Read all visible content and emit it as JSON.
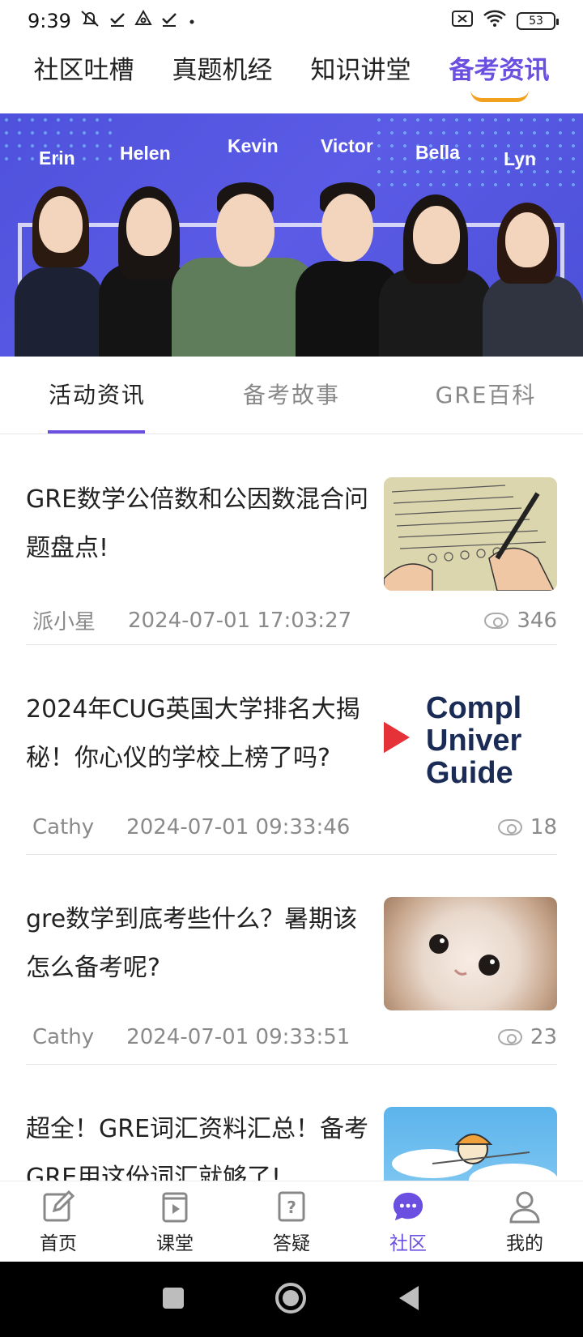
{
  "status": {
    "time": "9:39",
    "battery": "53"
  },
  "top_tabs": [
    {
      "label": "社区吐槽"
    },
    {
      "label": "真题机经"
    },
    {
      "label": "知识讲堂"
    },
    {
      "label": "备考资讯",
      "active": true
    }
  ],
  "banner": {
    "teachers": [
      "Erin",
      "Helen",
      "Kevin",
      "Victor",
      "Bella",
      "Lyn"
    ]
  },
  "sub_tabs": [
    {
      "label": "活动资讯",
      "active": true
    },
    {
      "label": "备考故事"
    },
    {
      "label": "GRE百科"
    }
  ],
  "articles": [
    {
      "title": "GRE数学公倍数和公因数混合问题盘点!",
      "author": "派小星",
      "date": "2024-07-01 17:03:27",
      "views": "346"
    },
    {
      "title": "2024年CUG英国大学排名大揭秘！你心仪的学校上榜了吗?",
      "author": "Cathy",
      "date": "2024-07-01 09:33:46",
      "views": "18",
      "thumb_text": [
        "Compl",
        "Univer",
        "Guide"
      ]
    },
    {
      "title": "gre数学到底考些什么？暑期该怎么备考呢?",
      "author": "Cathy",
      "date": "2024-07-01 09:33:51",
      "views": "23"
    },
    {
      "title": "超全！GRE词汇资料汇总！备考GRE用这份词汇就够了!",
      "author": "",
      "date": "",
      "views": ""
    }
  ],
  "bottom_nav": [
    {
      "label": "首页",
      "icon": "edit-icon"
    },
    {
      "label": "课堂",
      "icon": "play-book-icon"
    },
    {
      "label": "答疑",
      "icon": "question-icon"
    },
    {
      "label": "社区",
      "icon": "chat-bubble-icon",
      "active": true
    },
    {
      "label": "我的",
      "icon": "person-icon"
    }
  ],
  "colors": {
    "accent": "#6a4fe0",
    "underline": "#f2a020",
    "banner": "#5457e0"
  }
}
